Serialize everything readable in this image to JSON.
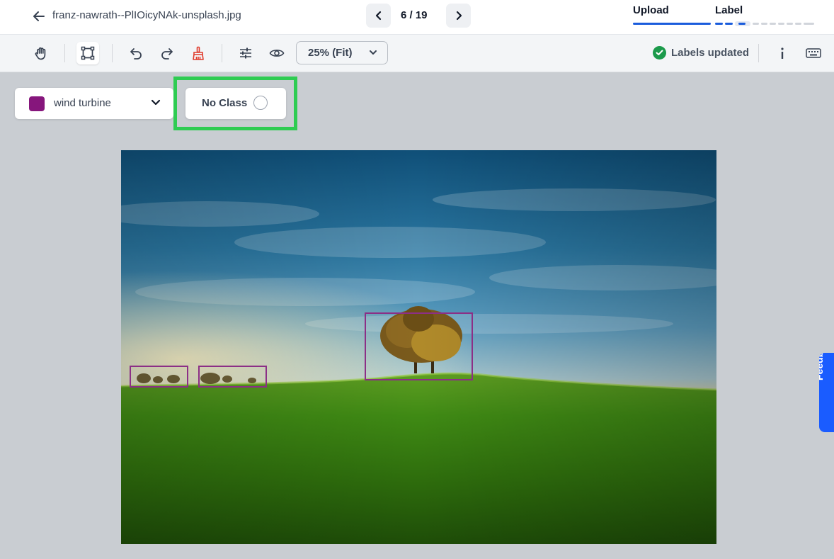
{
  "header": {
    "filename": "franz-nawrath--PlIOicyNAk-unsplash.jpg",
    "counter": "6 / 19",
    "steps": [
      {
        "label": "Upload",
        "color": "#1a5cdc",
        "state": "complete"
      },
      {
        "label": "Label",
        "color": "#1a5cdc",
        "state": "in-progress"
      }
    ]
  },
  "toolbar": {
    "tools": [
      {
        "name": "pan",
        "icon": "hand-icon"
      },
      {
        "name": "bounding-box",
        "icon": "bounding-box-icon",
        "active": true
      },
      {
        "name": "undo",
        "icon": "undo-icon"
      },
      {
        "name": "redo",
        "icon": "redo-icon"
      },
      {
        "name": "clear",
        "icon": "broom-icon",
        "color": "#e03b2c"
      },
      {
        "name": "adjustments",
        "icon": "sliders-icon"
      },
      {
        "name": "visibility",
        "icon": "eye-icon"
      }
    ],
    "zoom": "25% (Fit)",
    "status": "Labels updated",
    "info_icon": "info-icon",
    "keyboard_icon": "keyboard-icon"
  },
  "class_selector": {
    "selected": "wind turbine",
    "color": "#86167c"
  },
  "no_class": {
    "label": "No Class",
    "highlight_color": "#2ecc52"
  },
  "annotations": {
    "box_color": "#8c2f86",
    "count": 3
  },
  "feedback": {
    "label": "Feedback"
  }
}
